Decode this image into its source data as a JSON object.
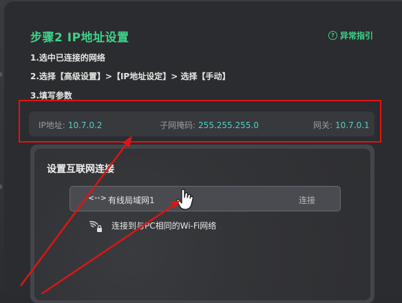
{
  "title": "步骤2 IP地址设置",
  "help_label": "异常指引",
  "steps": [
    "1.选中已连接的网络",
    "2.选择【高级设置】>【IP地址设定】> 选择【手动】",
    "3.填写参数"
  ],
  "params": {
    "ip_label": "IP地址:",
    "ip_value": "10.7.0.2",
    "mask_label": "子网掩码:",
    "mask_value": "255.255.255.0",
    "gateway_label": "网关:",
    "gateway_value": "10.7.0.1"
  },
  "dialog": {
    "title": "设置互联网连接",
    "wired": {
      "icon": "<··>",
      "label": "有线局域网1",
      "action": "连接"
    },
    "wifi": {
      "label": "连接到与PC相同的Wi-Fi网络"
    }
  },
  "colors": {
    "accent": "#3fd38a",
    "value": "#4fd2c8",
    "highlight": "#e01414"
  }
}
